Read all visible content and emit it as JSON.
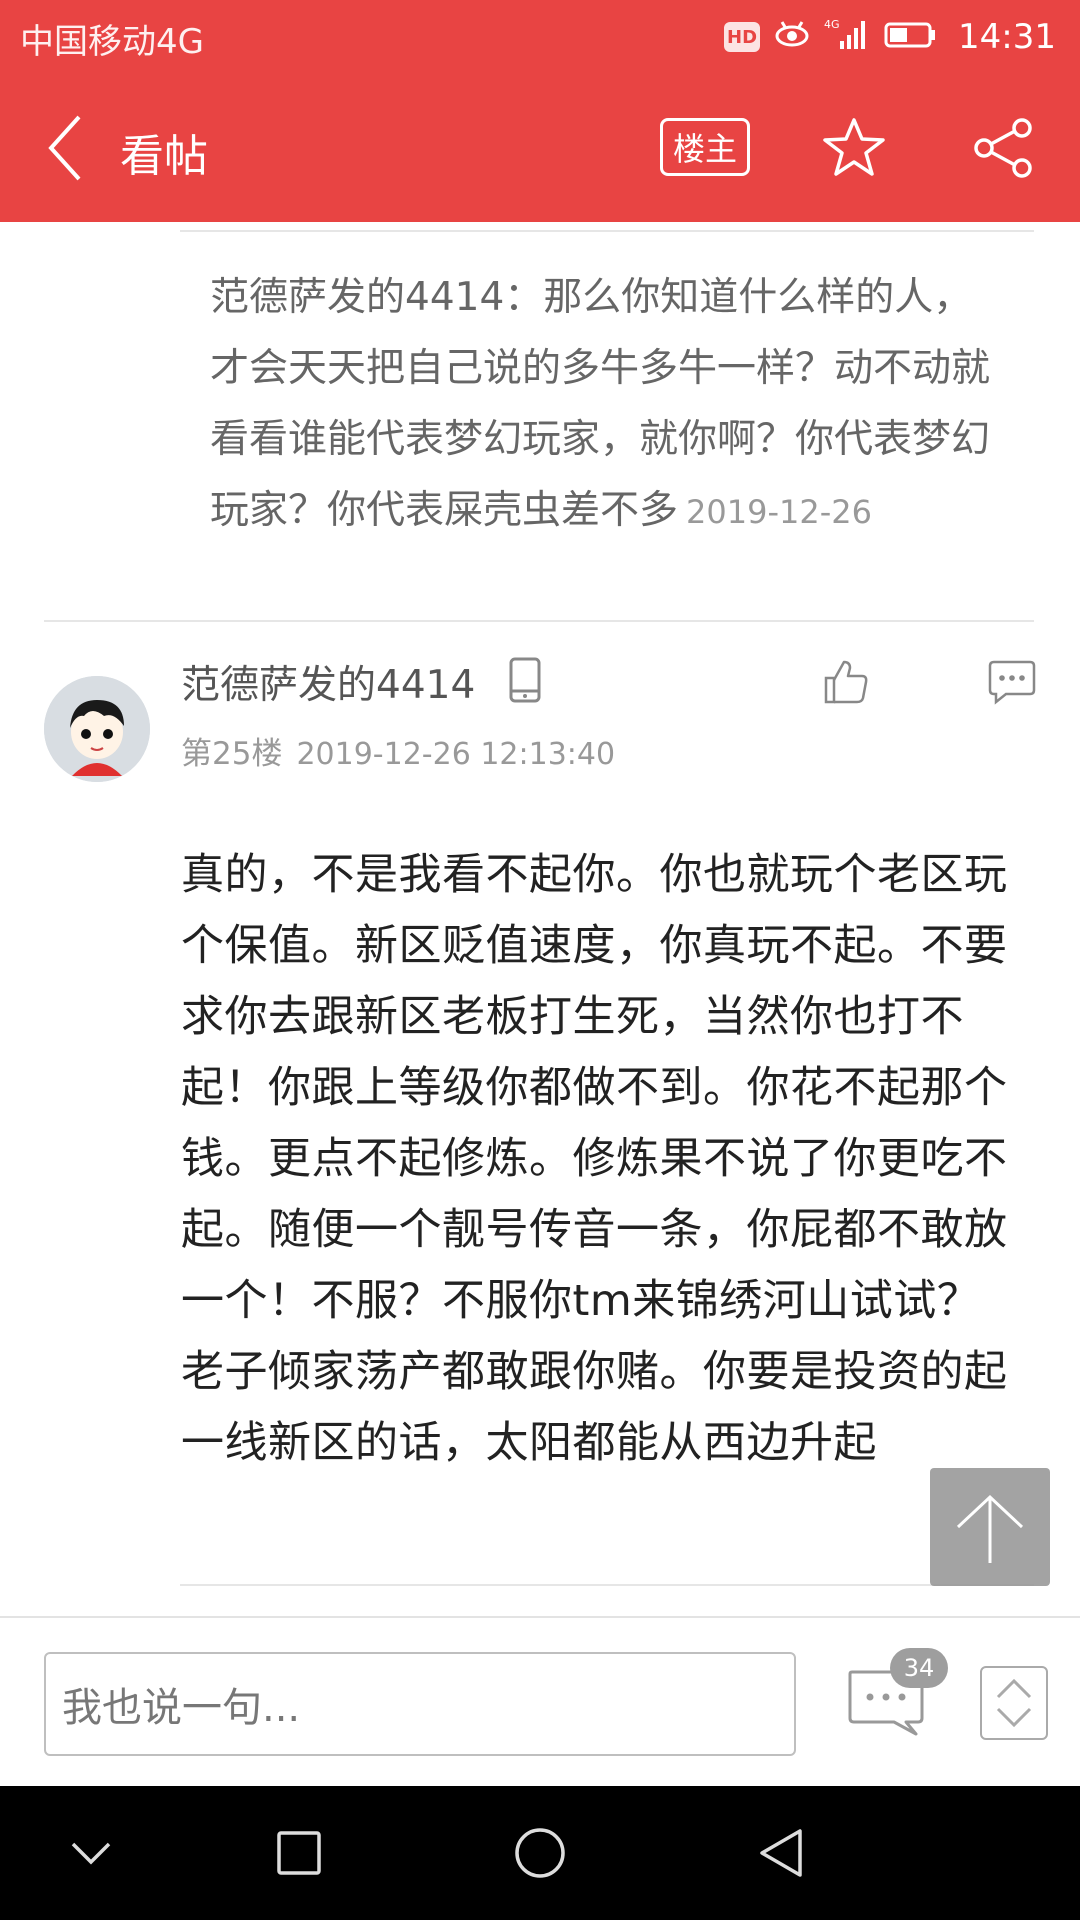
{
  "status_bar": {
    "carrier": "中国移动4G",
    "hd": "HD",
    "network": "4G",
    "time": "14:31"
  },
  "app_bar": {
    "title": "看帖",
    "op_button": "楼主",
    "icons": [
      "back-icon",
      "star-icon",
      "share-icon"
    ]
  },
  "quote": {
    "author": "范德萨发的4414",
    "separator": "：",
    "text": "那么你知道什么样的人，才会天天把自己说的多牛多牛一样？动不动就看看谁能代表梦幻玩家，就你啊？你代表梦幻玩家？你代表屎壳虫差不多",
    "date": "2019-12-26"
  },
  "post": {
    "username": "范德萨发的4414",
    "floor": "第25楼",
    "datetime": "2019-12-26 12:13:40",
    "body": "真的，不是我看不起你。你也就玩个老区玩个保值。新区贬值速度，你真玩不起。不要求你去跟新区老板打生死，当然你也打不起！你跟上等级你都做不到。你花不起那个钱。更点不起修炼。修炼果不说了你更吃不起。随便一个靓号传音一条，你屁都不敢放一个！不服？不服你tm来锦绣河山试试？老子倾家荡产都敢跟你赌。你要是投资的起一线新区的话，太阳都能从西边升起"
  },
  "bottom_bar": {
    "input_placeholder": "我也说一句...",
    "comment_count": "34"
  },
  "colors": {
    "brand_red": "#e84443",
    "nav_black": "#000000"
  }
}
